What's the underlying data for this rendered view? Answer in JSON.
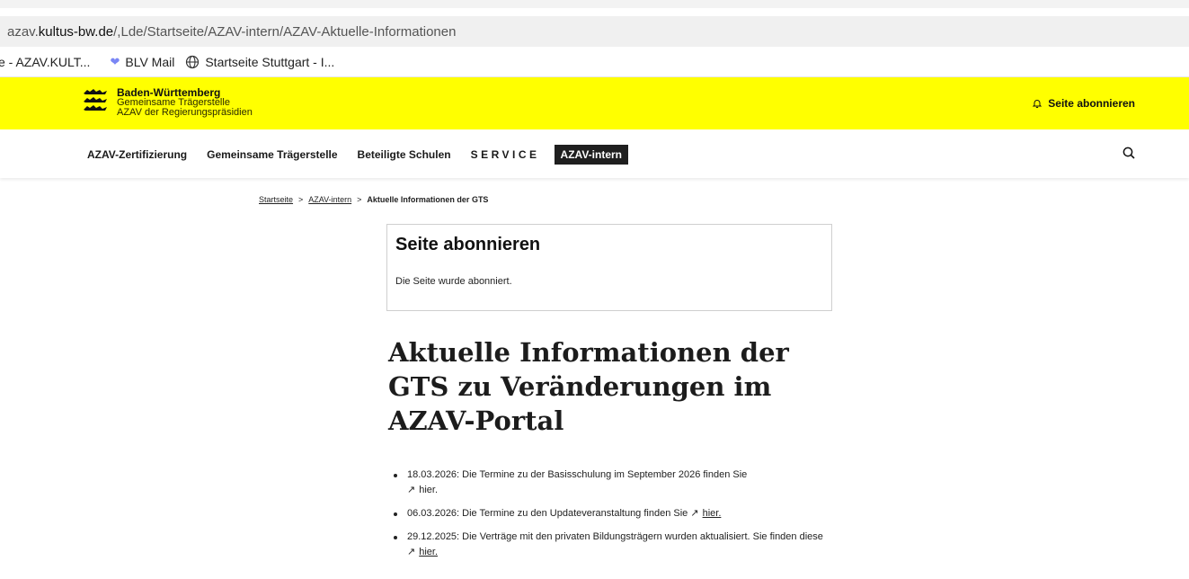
{
  "browser": {
    "url_prefix": "azav.",
    "url_domain": "kultus-bw.de",
    "url_path": "/,Lde/Startseite/AZAV-intern/AZAV-Aktuelle-Informationen",
    "bookmarks": [
      {
        "label": "e - AZAV.KULT...",
        "icon": ""
      },
      {
        "label": "BLV Mail",
        "icon": "heart-icon"
      },
      {
        "label": "Startseite Stuttgart - I...",
        "icon": "globe-icon"
      }
    ]
  },
  "header": {
    "logo_title": "Baden-Württemberg",
    "logo_line2": "Gemeinsame Trägerstelle",
    "logo_line3": "AZAV der Regierungspräsidien",
    "subscribe_label": "Seite abonnieren",
    "accent_color": "#ffff00"
  },
  "nav": {
    "items": [
      "AZAV-Zertifizierung",
      "Gemeinsame Trägerstelle",
      "Beteiligte Schulen",
      "SERVICE",
      "AZAV-intern"
    ],
    "active": "AZAV-intern"
  },
  "breadcrumb": {
    "items": [
      "Startseite",
      "AZAV-intern"
    ],
    "separator": ">",
    "current": "Aktuelle Informationen der GTS"
  },
  "subscribe_box": {
    "title": "Seite abonnieren",
    "message": "Die Seite wurde abonniert."
  },
  "page": {
    "title": "Aktuelle Informationen der GTS zu Veränderungen im AZAV-Portal",
    "items": [
      {
        "text": "18.03.2026: Die Termine zu der Basisschulung im September 2026 finden Sie",
        "link": "hier.",
        "suffix": ""
      },
      {
        "text": "06.03.2026: Die Termine zu den Updateveranstaltung finden Sie",
        "link": "hier.",
        "suffix": ""
      },
      {
        "text": "29.12.2025: Die Verträge mit den privaten Bildungsträgern wurden aktualisiert. Sie finden diese",
        "link": "hier.",
        "suffix": ""
      }
    ]
  }
}
